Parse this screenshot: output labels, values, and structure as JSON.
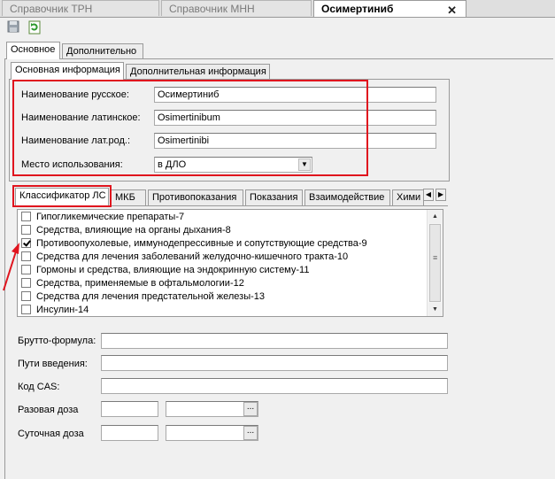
{
  "doc_tabs": [
    {
      "label": "Справочник ТРН"
    },
    {
      "label": "Справочник МНН"
    },
    {
      "label": "Осимертиниб"
    }
  ],
  "toolbar": {
    "save_icon": "save-disk-icon",
    "refresh_icon": "refresh-icon"
  },
  "main_tabs": [
    {
      "label": "Основное"
    },
    {
      "label": "Дополнительно"
    }
  ],
  "info_tabs": [
    {
      "label": "Основная информация"
    },
    {
      "label": "Дополнительная информация"
    }
  ],
  "form": {
    "name_ru": {
      "label": "Наименование русское:",
      "value": "Осимертиниб"
    },
    "name_lat": {
      "label": "Наименование латинское:",
      "value": "Osimertinibum"
    },
    "name_lat_gen": {
      "label": "Наименование лат.род.:",
      "value": "Osimertinibi"
    },
    "usage_place": {
      "label": "Место использования:",
      "value": "в ДЛО"
    }
  },
  "class_tabs": [
    {
      "label": "Классификатор ЛС"
    },
    {
      "label": "МКБ"
    },
    {
      "label": "Противопоказания"
    },
    {
      "label": "Показания"
    },
    {
      "label": "Взаимодействие"
    },
    {
      "label": "Хими"
    }
  ],
  "checklist": [
    {
      "label": "Гипогликемические препараты-7",
      "checked": false
    },
    {
      "label": "Средства, влияющие на органы дыхания-8",
      "checked": false
    },
    {
      "label": "Противоопухолевые, иммунодепрессивные и сопутствующие средства-9",
      "checked": true
    },
    {
      "label": "Средства для лечения заболеваний желудочно-кишечного тракта-10",
      "checked": false
    },
    {
      "label": "Гормоны и средства, влияющие на эндокринную систему-11",
      "checked": false
    },
    {
      "label": "Средства, применяемые в офтальмологии-12",
      "checked": false
    },
    {
      "label": "Средства для лечения предстательной железы-13",
      "checked": false
    },
    {
      "label": "Инсулин-14",
      "checked": false
    }
  ],
  "lower_form": {
    "brutto": {
      "label": "Брутто-формула:",
      "value": ""
    },
    "routes": {
      "label": "Пути введения:",
      "value": ""
    },
    "cas": {
      "label": "Код CAS:",
      "value": ""
    },
    "single_dose": {
      "label": "Разовая доза",
      "value": "",
      "unit": ""
    },
    "daily_dose": {
      "label": "Суточная доза",
      "value": "",
      "unit": ""
    },
    "ellipsis": "..."
  },
  "colors": {
    "highlight": "#e0141e"
  }
}
